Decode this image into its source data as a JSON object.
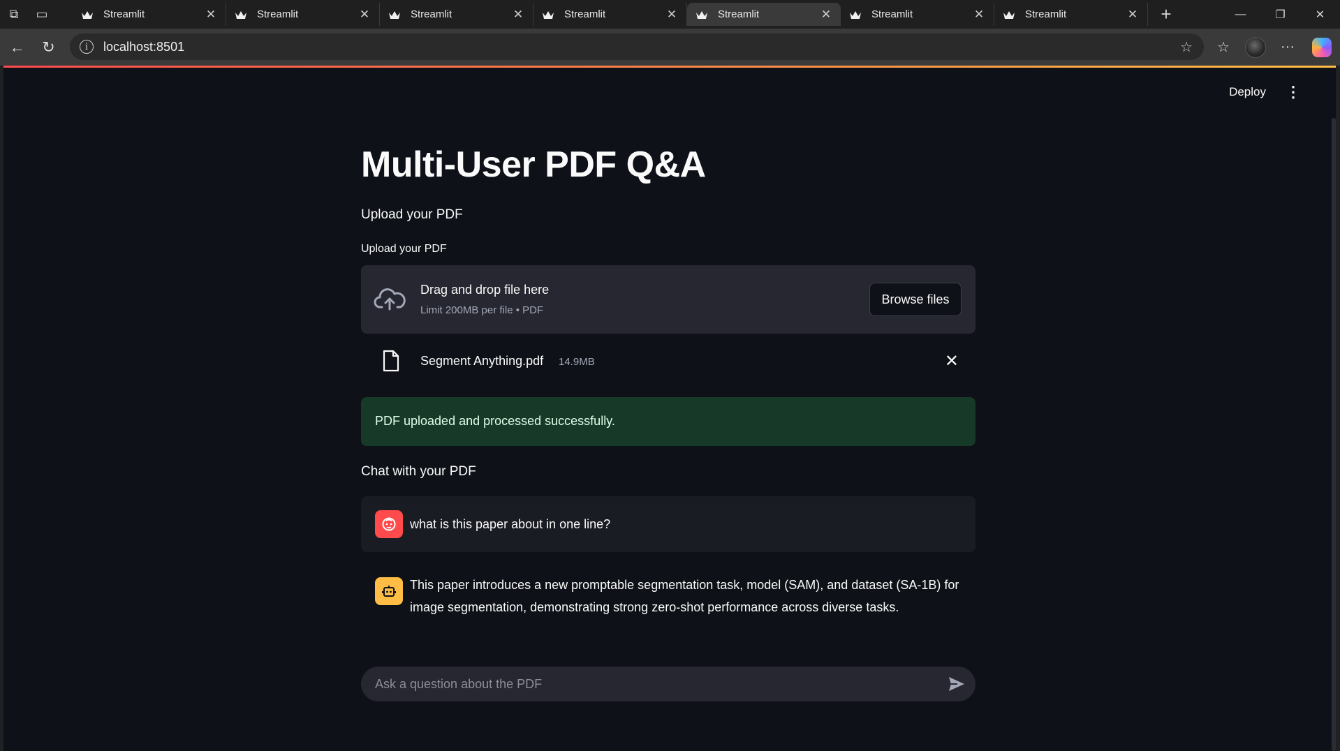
{
  "browser": {
    "tabs": [
      {
        "title": "Streamlit",
        "active": false
      },
      {
        "title": "Streamlit",
        "active": false
      },
      {
        "title": "Streamlit",
        "active": false
      },
      {
        "title": "Streamlit",
        "active": false
      },
      {
        "title": "Streamlit",
        "active": true
      },
      {
        "title": "Streamlit",
        "active": false
      },
      {
        "title": "Streamlit",
        "active": false
      }
    ],
    "url": "localhost:8501"
  },
  "app": {
    "deploy_label": "Deploy",
    "title": "Multi-User PDF Q&A",
    "upload_subheader": "Upload your PDF",
    "uploader_label": "Upload your PDF",
    "dropzone_title": "Drag and drop file here",
    "dropzone_limit": "Limit 200MB per file • PDF",
    "browse_label": "Browse files",
    "file": {
      "name": "Segment Anything.pdf",
      "size": "14.9MB"
    },
    "success_message": "PDF uploaded and processed successfully.",
    "chat_header": "Chat with your PDF",
    "messages": [
      {
        "role": "user",
        "text": "what is this paper about in one line?"
      },
      {
        "role": "assistant",
        "text": "This paper introduces a new promptable segmentation task, model (SAM), and dataset (SA-1B) for image segmentation, demonstrating strong zero-shot performance across diverse tasks."
      }
    ],
    "chat_placeholder": "Ask a question about the PDF"
  },
  "colors": {
    "background": "#0e1117",
    "secondary_bg": "#262730",
    "primary": "#ff4b4b",
    "success_bg": "#173928",
    "assistant_avatar": "#ffbd45"
  }
}
